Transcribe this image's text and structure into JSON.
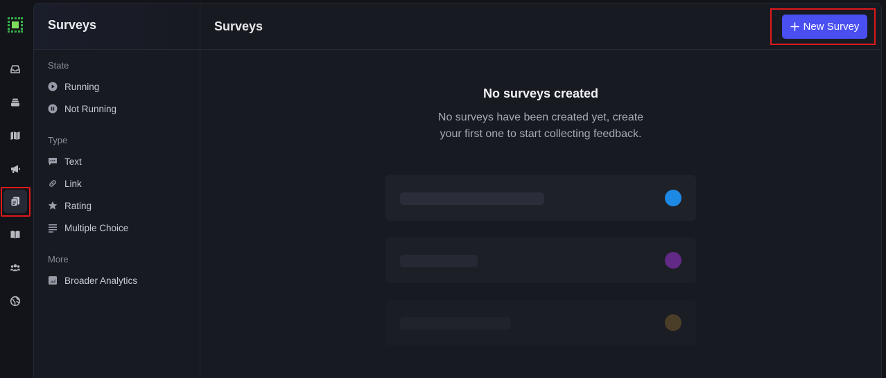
{
  "sidebar": {
    "title": "Surveys",
    "sections": [
      {
        "label": "State",
        "items": [
          {
            "label": "Running",
            "icon": "play-circle-icon"
          },
          {
            "label": "Not Running",
            "icon": "pause-circle-icon"
          }
        ]
      },
      {
        "label": "Type",
        "items": [
          {
            "label": "Text",
            "icon": "message-icon"
          },
          {
            "label": "Link",
            "icon": "link-icon"
          },
          {
            "label": "Rating",
            "icon": "star-icon"
          },
          {
            "label": "Multiple Choice",
            "icon": "list-icon"
          }
        ]
      },
      {
        "label": "More",
        "items": [
          {
            "label": "Broader Analytics",
            "icon": "chart-icon"
          }
        ]
      }
    ]
  },
  "header": {
    "title": "Surveys",
    "new_button_label": "New Survey"
  },
  "empty": {
    "title": "No surveys created",
    "line1": "No surveys have been created yet, create",
    "line2": "your first one to start collecting feedback."
  },
  "colors": {
    "accent": "#4a4ff2",
    "dot1": "#1e88e5",
    "dot2": "#7b2ea8",
    "dot3": "#6b5028",
    "highlight": "#e0191b"
  }
}
